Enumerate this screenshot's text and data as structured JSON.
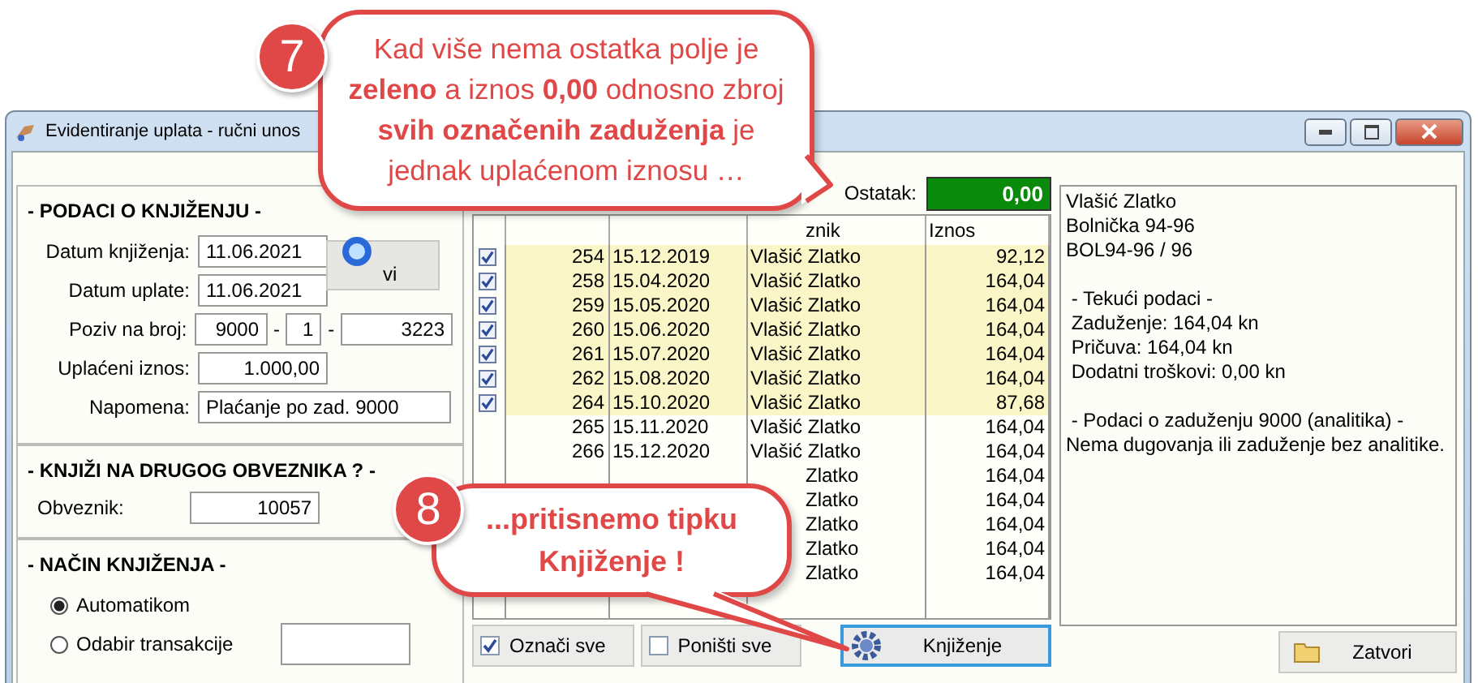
{
  "window": {
    "title": "Evidentiranje uplata - ručni unos"
  },
  "posting": {
    "heading": "- PODACI O KNJIŽENJU -",
    "side_button": "vi",
    "fields": [
      {
        "kind": "date",
        "label": "Datum knjiženja:",
        "value": "11.06.2021"
      },
      {
        "kind": "date",
        "label": "Datum uplate:",
        "value": "11.06.2021"
      },
      {
        "kind": "reference",
        "label": "Poziv na broj:",
        "parts": [
          "9000",
          "1",
          "3223"
        ],
        "separators": [
          "-",
          "-"
        ]
      },
      {
        "kind": "amount",
        "label": "Uplaćeni iznos:",
        "value": "1.000,00"
      },
      {
        "kind": "wide",
        "label": "Napomena:",
        "value": "Plaćanje po zad. 9000"
      }
    ]
  },
  "other_payer": {
    "heading": "- KNJIŽI NA DRUGOG OBVEZNIKA ? -",
    "label": "Obveznik:",
    "value": "10057"
  },
  "posting_method": {
    "heading": "- NAČIN KNJIŽENJA -",
    "options": [
      {
        "label": "Automatikom",
        "selected": true
      },
      {
        "label": "Odabir transakcije",
        "selected": false
      }
    ]
  },
  "remainder": {
    "label": "Ostatak:",
    "value": "0,00"
  },
  "table": {
    "columns": [
      {
        "label": "znik"
      },
      {
        "label": "Iznos"
      }
    ],
    "rows": [
      {
        "checked": true,
        "number": "254",
        "date": "15.12.2019",
        "payer": "Vlašić Zlatko",
        "amount": "92,12"
      },
      {
        "checked": true,
        "number": "258",
        "date": "15.04.2020",
        "payer": "Vlašić Zlatko",
        "amount": "164,04"
      },
      {
        "checked": true,
        "number": "259",
        "date": "15.05.2020",
        "payer": "Vlašić Zlatko",
        "amount": "164,04"
      },
      {
        "checked": true,
        "number": "260",
        "date": "15.06.2020",
        "payer": "Vlašić Zlatko",
        "amount": "164,04"
      },
      {
        "checked": true,
        "number": "261",
        "date": "15.07.2020",
        "payer": "Vlašić Zlatko",
        "amount": "164,04"
      },
      {
        "checked": true,
        "number": "262",
        "date": "15.08.2020",
        "payer": "Vlašić Zlatko",
        "amount": "164,04"
      },
      {
        "checked": true,
        "number": "264",
        "date": "15.10.2020",
        "payer": "Vlašić Zlatko",
        "amount": "87,68"
      },
      {
        "checked": false,
        "number": "265",
        "date": "15.11.2020",
        "payer": "Vlašić Zlatko",
        "amount": "164,04"
      },
      {
        "checked": false,
        "number": "266",
        "date": "15.12.2020",
        "payer": "Vlašić Zlatko",
        "amount": "164,04"
      },
      {
        "checked": false,
        "payer": "Zlatko",
        "amount": "164,04"
      },
      {
        "checked": false,
        "payer": "Zlatko",
        "amount": "164,04"
      },
      {
        "checked": false,
        "payer": "Zlatko",
        "amount": "164,04"
      },
      {
        "checked": false,
        "payer": "Zlatko",
        "amount": "164,04"
      },
      {
        "checked": false,
        "payer": "Zlatko",
        "amount": "164,04"
      }
    ]
  },
  "table_buttons": [
    {
      "kind": "check",
      "label": "Označi sve"
    },
    {
      "kind": "uncheck",
      "label": "Poništi sve"
    }
  ],
  "post_button": {
    "label": "Knjiženje"
  },
  "info_panel": {
    "blocks": [
      {
        "lines": [
          "Vlašić Zlatko",
          "Bolnička 94-96",
          "BOL94-96 / 96"
        ]
      },
      {
        "lines": [
          " - Tekući podaci -",
          " Zaduženje: 164,04 kn",
          " Pričuva: 164,04 kn",
          " Dodatni troškovi: 0,00 kn"
        ]
      },
      {
        "lines": [
          " - Podaci o zaduženju 9000 (analitika) -",
          "Nema dugovanja ili zaduženje bez analitike."
        ]
      }
    ]
  },
  "close_button": {
    "label": "Zatvori"
  },
  "callouts": [
    {
      "kind": "note",
      "number": "7",
      "text": "Kad više nema ostatka polje je **zeleno** a iznos **0,00** odnosno zbroj **svih označenih zaduženja** je jednak uplaćenom iznosu …"
    },
    {
      "kind": "action",
      "number": "8",
      "text": "...pritisnemo tipku Knjiženje !"
    }
  ]
}
